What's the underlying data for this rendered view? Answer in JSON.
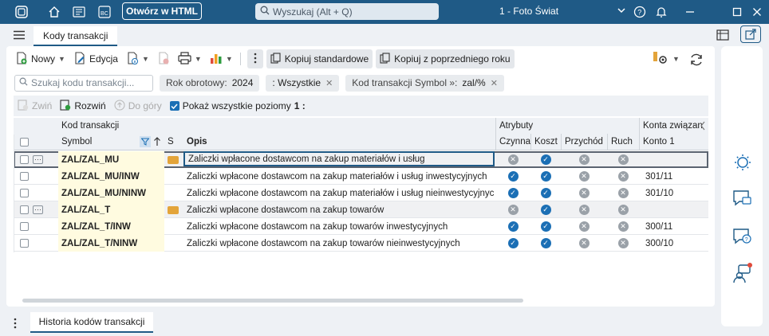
{
  "titlebar": {
    "open_html": "Otwórz w HTML",
    "search_placeholder": "Wyszukaj (Alt + Q)",
    "company": "1 - Foto Świat"
  },
  "tabs": {
    "active": "Kody transakcji"
  },
  "toolbar": {
    "new": "Nowy",
    "edit": "Edycja",
    "copy_standard": "Kopiuj standardowe",
    "copy_prev": "Kopiuj z poprzedniego roku"
  },
  "filters": {
    "search_placeholder": "Szukaj kodu transakcji...",
    "year_label": "Rok obrotowy:",
    "year_value": "2024",
    "all": ": Wszystkie",
    "code_label": "Kod transakcji Symbol »:",
    "code_value": "zal/%"
  },
  "tree": {
    "collapse": "Zwiń",
    "expand": "Rozwiń",
    "up": "Do góry",
    "show_all": "Pokaż wszystkie poziomy",
    "level": "1 :"
  },
  "grid": {
    "group_code": "Kod transakcji",
    "group_attr": "Atrybuty",
    "group_accounts": "Konta związan",
    "col_symbol": "Symbol",
    "col_s": "S",
    "col_desc": "Opis",
    "col_active": "Czynna",
    "col_cost": "Koszt",
    "col_income": "Przychód",
    "col_move": "Ruch",
    "col_acc1": "Konto 1",
    "rows": [
      {
        "symbol": "ZAL/ZAL_MU",
        "desc": "Zaliczki wpłacone dostawcom na zakup materiałów i usług",
        "active": false,
        "cost": true,
        "income": false,
        "move": false,
        "acc1": "",
        "group": true
      },
      {
        "symbol": "ZAL/ZAL_MU/INW",
        "desc": "Zaliczki wpłacone dostawcom na zakup materiałów i usług inwestycyjnych",
        "active": true,
        "cost": true,
        "income": false,
        "move": false,
        "acc1": "301/11",
        "group": false
      },
      {
        "symbol": "ZAL/ZAL_MU/NINW",
        "desc": "Zaliczki wpłacone dostawcom na zakup materiałów i usług nieinwestycyjnych",
        "active": true,
        "cost": true,
        "income": false,
        "move": false,
        "acc1": "301/10",
        "group": false
      },
      {
        "symbol": "ZAL/ZAL_T",
        "desc": "Zaliczki wpłacone dostawcom na zakup towarów",
        "active": false,
        "cost": true,
        "income": false,
        "move": false,
        "acc1": "",
        "group": true
      },
      {
        "symbol": "ZAL/ZAL_T/INW",
        "desc": "Zaliczki wpłacone dostawcom  na zakup towarów inwestycyjnych",
        "active": true,
        "cost": true,
        "income": false,
        "move": false,
        "acc1": "300/11",
        "group": false
      },
      {
        "symbol": "ZAL/ZAL_T/NINW",
        "desc": "Zaliczki wpłacone dostawcom  na zakup towarów nieinwestycyjnych",
        "active": true,
        "cost": true,
        "income": false,
        "move": false,
        "acc1": "300/10",
        "group": false
      }
    ]
  },
  "bottom": {
    "history_tab": "Historia kodów transakcji"
  }
}
